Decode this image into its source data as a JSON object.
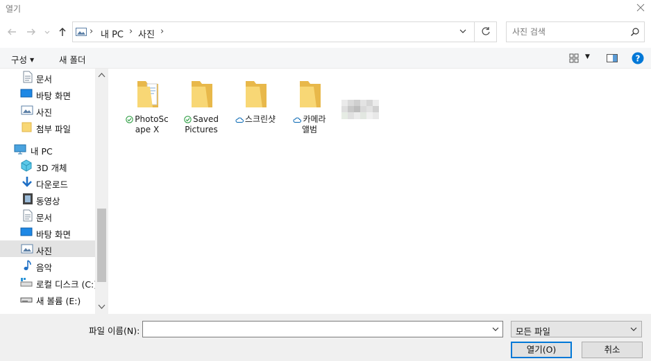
{
  "window": {
    "title": "열기"
  },
  "address": {
    "crumbs": [
      "내 PC",
      "사진"
    ]
  },
  "search": {
    "placeholder": "사진 검색"
  },
  "toolbar": {
    "organize": "구성",
    "new_folder": "새 폴더"
  },
  "nav": {
    "items": [
      {
        "label": "문서",
        "icon": "document-icon"
      },
      {
        "label": "바탕 화면",
        "icon": "desktop-icon"
      },
      {
        "label": "사진",
        "icon": "pictures-icon"
      },
      {
        "label": "첨부 파일",
        "icon": "folder-icon"
      },
      {
        "label": "내 PC",
        "icon": "pc-icon"
      },
      {
        "label": "3D 개체",
        "icon": "cube-icon"
      },
      {
        "label": "다운로드",
        "icon": "download-icon"
      },
      {
        "label": "동영상",
        "icon": "video-icon"
      },
      {
        "label": "문서",
        "icon": "document-icon"
      },
      {
        "label": "바탕 화면",
        "icon": "desktop-icon"
      },
      {
        "label": "사진",
        "icon": "pictures-icon",
        "selected": true
      },
      {
        "label": "음악",
        "icon": "music-icon"
      },
      {
        "label": "로컬 디스크 (C:)",
        "icon": "drive-icon"
      },
      {
        "label": "새 볼륨 (E:)",
        "icon": "drive-icon"
      }
    ]
  },
  "files": [
    {
      "line1": "PhotoSc",
      "line2": "ape X",
      "status": "synced",
      "kind": "folder-with-docs"
    },
    {
      "line1": "Saved",
      "line2": "Pictures",
      "status": "synced",
      "kind": "folder"
    },
    {
      "line1": "스크린샷",
      "line2": "",
      "status": "cloud",
      "kind": "folder"
    },
    {
      "line1": "카메라",
      "line2": "앨범",
      "status": "cloud",
      "kind": "folder"
    }
  ],
  "footer": {
    "filename_label": "파일 이름(N):",
    "filename_value": "",
    "filetype_value": "모든 파일",
    "open_label": "열기(O)",
    "cancel_label": "취소"
  },
  "colors": {
    "accent": "#0078d7",
    "folder": "#f8d775",
    "synced": "#2f9e44",
    "cloud": "#0063b1"
  }
}
